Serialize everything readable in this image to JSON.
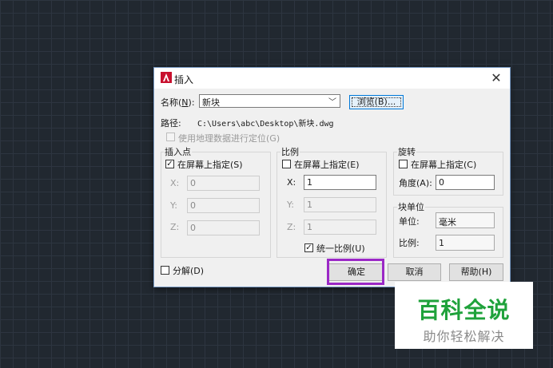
{
  "dialog": {
    "title": "插入",
    "close_glyph": "✕",
    "app_icon": "autocad-logo-icon"
  },
  "name_row": {
    "label_prefix": "名称(",
    "label_hotkey": "N",
    "label_suffix": "):",
    "value": "新块",
    "browse_label": "浏览(B)..."
  },
  "path_row": {
    "label": "路径:",
    "value": "C:\\Users\\abc\\Desktop\\新块.dwg"
  },
  "geo": {
    "label": "使用地理数据进行定位(G)",
    "checked": false
  },
  "insert_point": {
    "title": "插入点",
    "onscreen_label": "在屏幕上指定(S)",
    "onscreen_checked": true,
    "x_label": "X:",
    "x_value": "0",
    "y_label": "Y:",
    "y_value": "0",
    "z_label": "Z:",
    "z_value": "0"
  },
  "scale": {
    "title": "比例",
    "onscreen_label": "在屏幕上指定(E)",
    "onscreen_checked": false,
    "x_label": "X:",
    "x_value": "1",
    "y_label": "Y:",
    "y_value": "1",
    "z_label": "Z:",
    "z_value": "1",
    "uniform_label": "统一比例(U)",
    "uniform_checked": true
  },
  "rotation": {
    "title": "旋转",
    "onscreen_label": "在屏幕上指定(C)",
    "onscreen_checked": false,
    "angle_label": "角度(A):",
    "angle_value": "0"
  },
  "block_unit": {
    "title": "块单位",
    "unit_label": "单位:",
    "unit_value": "毫米",
    "factor_label": "比例:",
    "factor_value": "1"
  },
  "explode": {
    "label": "分解(D)",
    "checked": false
  },
  "buttons": {
    "ok": "确定",
    "cancel": "取消",
    "help": "帮助(H)"
  },
  "colors": {
    "highlight": "#9b28c6",
    "watermark_green": "#1fa23b"
  },
  "watermark": {
    "title": "百科全说",
    "subtitle": "助你轻松解决"
  }
}
